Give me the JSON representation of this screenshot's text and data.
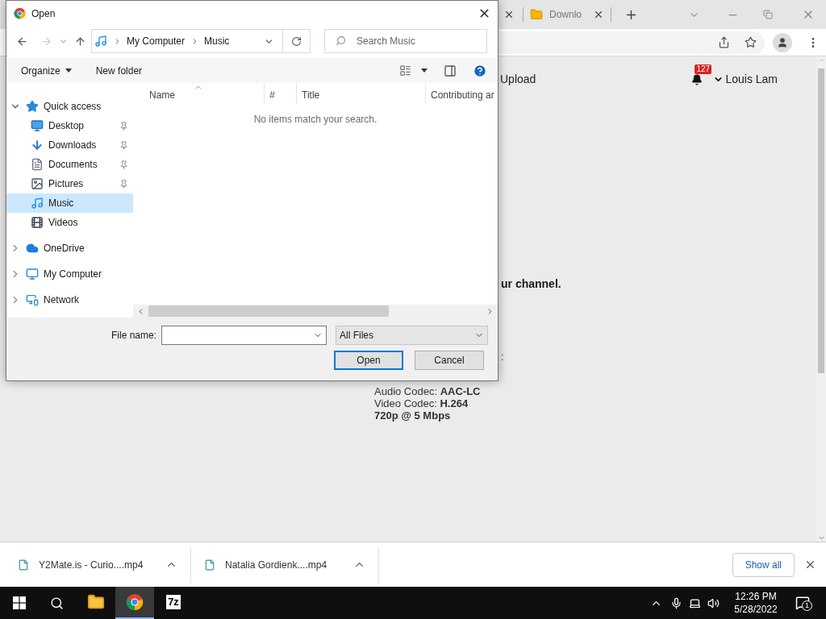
{
  "browser": {
    "tabs": [
      {
        "label": "Downlo",
        "selected": false
      }
    ]
  },
  "page": {
    "nav_link": "Upload",
    "notification_count": "127",
    "user": "Louis Lam",
    "channel_text": "ur channel.",
    "fragment": ":",
    "codec_lines": [
      "Audio Codec: **AAC-LC**",
      "Video Codec: **H.264**"
    ],
    "quality": "720p @ 5 Mbps"
  },
  "dialog": {
    "title": "Open",
    "back_disabled": false,
    "forward_disabled": true,
    "breadcrumb": [
      "My Computer",
      "Music"
    ],
    "search_placeholder": "Search Music",
    "toolbar": {
      "organize": "Organize",
      "new_folder": "New folder"
    },
    "nav_tree": [
      {
        "label": "Quick access",
        "kind": "star",
        "expanded": true,
        "selected": false,
        "children": [
          {
            "label": "Desktop",
            "kind": "desktop",
            "pinned": true,
            "selected": false
          },
          {
            "label": "Downloads",
            "kind": "download",
            "pinned": true,
            "selected": false
          },
          {
            "label": "Documents",
            "kind": "document",
            "pinned": true,
            "selected": false
          },
          {
            "label": "Pictures",
            "kind": "picture",
            "pinned": true,
            "selected": false
          },
          {
            "label": "Music",
            "kind": "music",
            "pinned": false,
            "selected": true
          },
          {
            "label": "Videos",
            "kind": "video",
            "pinned": false,
            "selected": false
          }
        ]
      },
      {
        "label": "OneDrive",
        "kind": "cloud",
        "expanded": false,
        "selected": false
      },
      {
        "label": "My Computer",
        "kind": "computer",
        "expanded": false,
        "selected": false
      },
      {
        "label": "Network",
        "kind": "network",
        "expanded": false,
        "selected": false
      }
    ],
    "columns": [
      {
        "label": "Name",
        "sorted": true
      },
      {
        "label": "#",
        "sorted": false
      },
      {
        "label": "Title",
        "sorted": false
      },
      {
        "label": "Contributing ar",
        "sorted": false
      }
    ],
    "empty_message": "No items match your search.",
    "file_name_label": "File name:",
    "file_type": "All Files",
    "buttons": [
      {
        "label": "Open",
        "kind": "default"
      },
      {
        "label": "Cancel",
        "kind": "normal"
      }
    ]
  },
  "downloads": {
    "items": [
      {
        "name": "Y2Mate.is - Curio....mp4"
      },
      {
        "name": "Natalia Gordienk....mp4"
      }
    ],
    "show_all": "Show all"
  },
  "taskbar": {
    "apps": [
      {
        "kind": "files",
        "selected": false
      },
      {
        "kind": "chrome",
        "selected": true
      },
      {
        "kind": "archiver",
        "label": "7z",
        "selected": false
      }
    ],
    "time": "12:26 PM",
    "date": "5/28/2022",
    "notification_count": "1"
  }
}
